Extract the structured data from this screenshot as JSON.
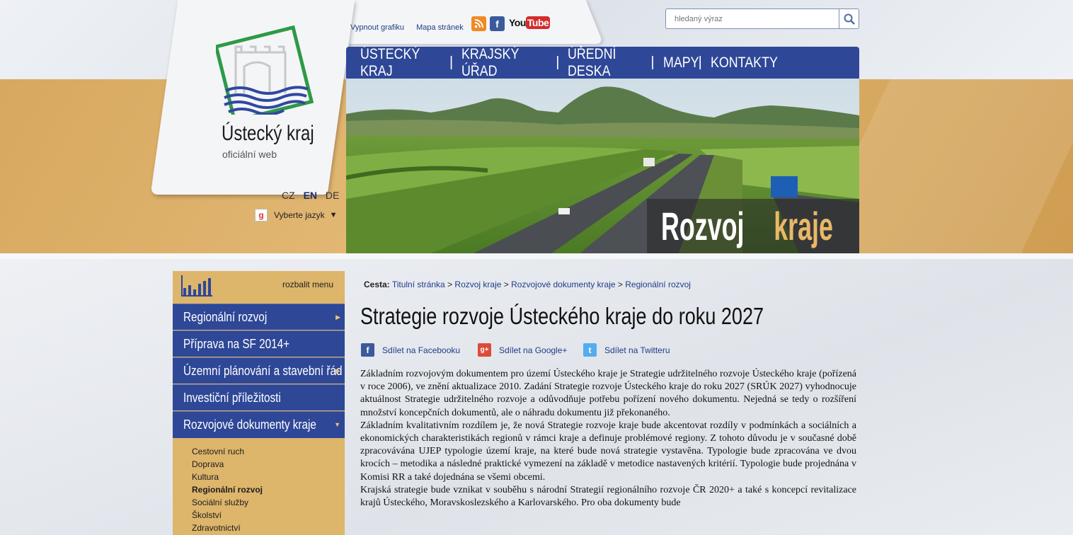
{
  "header": {
    "logo_title": "Ústecký kraj",
    "logo_subtitle": "oficiální web",
    "links": [
      "Vypnout grafiku",
      "Mapa stránek"
    ],
    "social": {
      "rss": "RSS",
      "facebook": "f",
      "youtube": "YouTube"
    },
    "search_placeholder": "hledaný výraz",
    "languages": [
      "CZ",
      "EN",
      "DE"
    ],
    "translate_label": "Vyberte jazyk"
  },
  "nav": [
    "ÚSTECKÝ KRAJ",
    "KRAJSKÝ ÚŘAD",
    "ÚŘEDNÍ DESKA",
    "MAPY",
    "KONTAKTY"
  ],
  "hero": {
    "title_main": "Rozvoj",
    "title_accent": "kraje"
  },
  "sidebar": {
    "expand_label": "rozbalit menu",
    "items": [
      {
        "label": "Regionální rozvoj"
      },
      {
        "label": "Příprava na SF 2014+"
      },
      {
        "label": "Územní plánování a stavební řád"
      },
      {
        "label": "Investiční příležitosti"
      },
      {
        "label": "Rozvojové dokumenty kraje"
      }
    ],
    "subitems": [
      "Cestovní ruch",
      "Doprava",
      "Kultura",
      "Regionální rozvoj",
      "Sociální služby",
      "Školství",
      "Zdravotnictví"
    ]
  },
  "breadcrumb": {
    "label": "Cesta:",
    "items": [
      "Titulní stránka",
      "Rozvoj kraje",
      "Rozvojové dokumenty kraje",
      "Regionální rozvoj"
    ]
  },
  "article": {
    "title": "Strategie rozvoje Ústeckého kraje do roku 2027",
    "share": [
      "Sdílet na Facebooku",
      "Sdílet na Google+",
      "Sdílet na Twitteru"
    ],
    "paragraphs": [
      "Základním rozvojovým dokumentem pro území Ústeckého kraje je Strategie udržitelného rozvoje Ústeckého kraje (pořízená v roce 2006), ve znění aktualizace 2010. Zadání Strategie rozvoje Ústeckého kraje do roku 2027 (SRÚK 2027) vyhodnocuje aktuálnost Strategie udržitelného rozvoje a odůvodňuje potřebu pořízení nového dokumentu. Nejedná se tedy o rozšíření množství koncepčních dokumentů, ale o náhradu dokumentu již překonaného.",
      "Základním kvalitativním rozdílem je, že nová Strategie rozvoje kraje bude akcentovat rozdíly v podmínkách a sociálních a ekonomických charakteristikách regionů v rámci kraje a definuje problémové regiony. Z tohoto důvodu je v současné době zpracovávána UJEP typologie území kraje, na které bude nová strategie vystavěna. Typologie bude zpracována ve dvou krocích – metodika a následné praktické vymezení na základě v metodice nastavených kritérií. Typologie bude projednána v Komisi RR a také dojednána se všemi obcemi.",
      "Krajská strategie bude vznikat v souběhu s národní Strategií regionálního rozvoje ČR 2020+ a také s koncepcí revitalizace krajů Ústeckého, Moravskoslezského a Karlovarského. Pro oba dokumenty bude"
    ]
  },
  "colors": {
    "nav_blue": "#2e4797",
    "gold": "#ddb56b",
    "link": "#1e3c8a"
  }
}
